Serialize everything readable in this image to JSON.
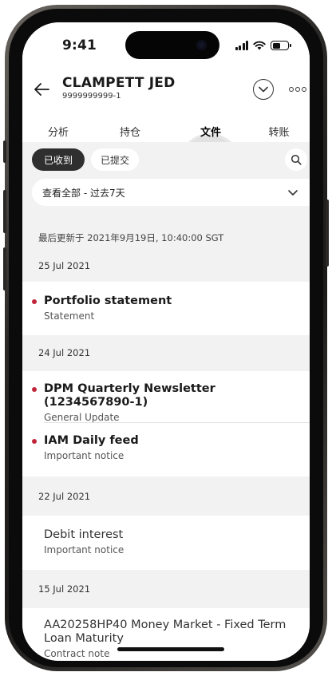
{
  "status_bar": {
    "time": "9:41"
  },
  "header": {
    "account_name": "CLAMPETT JED",
    "account_number": "9999999999-1"
  },
  "tabs": [
    {
      "label": "分析",
      "active": false
    },
    {
      "label": "持仓",
      "active": false
    },
    {
      "label": "文件",
      "active": true
    },
    {
      "label": "转账",
      "active": false
    }
  ],
  "filters": {
    "chips": [
      {
        "label": "已收到",
        "selected": true
      },
      {
        "label": "已提交",
        "selected": false
      }
    ],
    "period_select": "查看全部 - 过去7天"
  },
  "last_updated": "最后更新于 2021年9月19日, 10:40:00 SGT",
  "groups": [
    {
      "date": "25 Jul 2021",
      "items": [
        {
          "title": "Portfolio statement",
          "subtitle": "Statement",
          "unread": true
        }
      ]
    },
    {
      "date": "24 Jul 2021",
      "items": [
        {
          "title": "DPM Quarterly Newsletter (1234567890-1)",
          "subtitle": "General Update",
          "unread": true
        },
        {
          "title": "IAM Daily feed",
          "subtitle": "Important notice",
          "unread": true
        }
      ]
    },
    {
      "date": "22 Jul 2021",
      "items": [
        {
          "title": "Debit interest",
          "subtitle": "Important notice",
          "unread": false
        }
      ]
    },
    {
      "date": "15 Jul 2021",
      "items": [
        {
          "title": "AA20258HP40 Money Market - Fixed Term Loan Maturity",
          "subtitle": "Contract note",
          "unread": false
        }
      ]
    }
  ],
  "colors": {
    "unread_dot": "#c0263a",
    "selected_chip": "#2f2f2f",
    "page_background": "#f2f2f2"
  }
}
